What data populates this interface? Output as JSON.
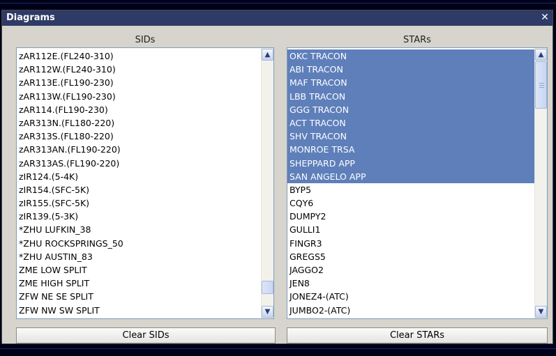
{
  "window": {
    "title": "Diagrams"
  },
  "sids": {
    "header": "SIDs",
    "items": [
      "zAR112E.(FL240-310)",
      "zAR112W.(FL240-310)",
      "zAR113E.(FL190-230)",
      "zAR113W.(FL190-230)",
      "zAR114.(FL190-230)",
      "zAR313N.(FL180-220)",
      "zAR313S.(FL180-220)",
      "zAR313AN.(FL190-220)",
      "zAR313AS.(FL190-220)",
      "zIR124.(5-4K)",
      "zIR154.(SFC-5K)",
      "zIR155.(SFC-5K)",
      "zIR139.(5-3K)",
      "*ZHU LUFKIN_38",
      "*ZHU ROCKSPRINGS_50",
      "*ZHU AUSTIN_83",
      "ZME LOW SPLIT",
      "ZME HIGH SPLIT",
      "ZFW NE SE SPLIT",
      "ZFW NW SW SPLIT"
    ],
    "clear_label": "Clear SIDs"
  },
  "stars": {
    "header": "STARs",
    "items": [
      "OKC TRACON",
      "ABI TRACON",
      "MAF TRACON",
      "LBB TRACON",
      "GGG TRACON",
      "ACT TRACON",
      "SHV TRACON",
      "MONROE TRSA",
      "SHEPPARD APP",
      "SAN ANGELO APP",
      "BYP5",
      "CQY6",
      "DUMPY2",
      "GULLI1",
      "FINGR3",
      "GREGS5",
      "JAGGO2",
      "JEN8",
      "JONEZ4-(ATC)",
      "JUMBO2-(ATC)"
    ],
    "selected_count": 10,
    "clear_label": "Clear STARs"
  },
  "icons": {
    "close": "close-icon",
    "scroll_up": "scroll-up-arrow-icon",
    "scroll_down": "scroll-down-arrow-icon"
  },
  "colors": {
    "titlebar": "#2e3b66",
    "selection": "#5e7fba",
    "window": "#d6d4cc"
  }
}
